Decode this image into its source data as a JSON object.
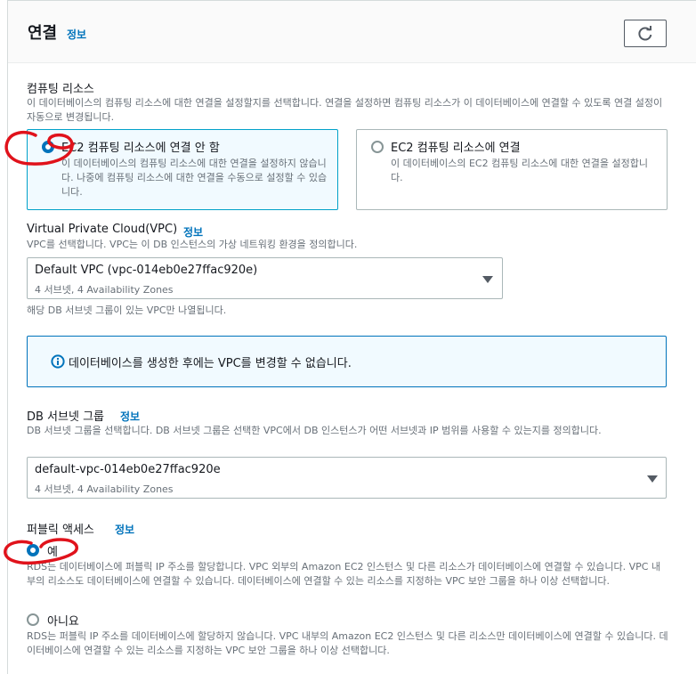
{
  "header": {
    "title": "연결",
    "info": "정보"
  },
  "compute": {
    "label": "컴퓨팅 리소스",
    "description": "이 데이터베이스의 컴퓨팅 리소스에 대한 연결을 설정할지를 선택합니다. 연결을 설정하면 컴퓨팅 리소스가 이 데이터베이스에 연결할 수 있도록 연결 설정이 자동으로 변경됩니다.",
    "options": [
      {
        "title": "EC2 컴퓨팅 리소스에 연결 안 함",
        "description": "이 데이터베이스의 컴퓨팅 리소스에 대한 연결을 설정하지 않습니다. 나중에 컴퓨팅 리소스에 대한 연결을 수동으로 설정할 수 있습니다.",
        "selected": true
      },
      {
        "title": "EC2 컴퓨팅 리소스에 연결",
        "description": "이 데이터베이스의 EC2 컴퓨팅 리소스에 대한 연결을 설정합니다.",
        "selected": false
      }
    ]
  },
  "vpc": {
    "label": "Virtual Private Cloud(VPC)",
    "info": "정보",
    "description": "VPC를 선택합니다. VPC는 이 DB 인스턴스의 가상 네트워킹 환경을 정의합니다.",
    "selected": "Default VPC (vpc-014eb0e27ffac920e)",
    "sub": "4 서브넷, 4 Availability Zones",
    "hint": "해당 DB 서브넷 그룹이 있는 VPC만 나열됩니다."
  },
  "alert": {
    "text": "데이터베이스를 생성한 후에는 VPC를 변경할 수 없습니다."
  },
  "subnet": {
    "label": "DB 서브넷 그룹",
    "info": "정보",
    "description": "DB 서브넷 그룹을 선택합니다. DB 서브넷 그룹은 선택한 VPC에서 DB 인스턴스가 어떤 서브넷과 IP 범위를 사용할 수 있는지를 정의합니다.",
    "selected": "default-vpc-014eb0e27ffac920e",
    "sub": "4 서브넷, 4 Availability Zones"
  },
  "public_access": {
    "label": "퍼블릭 액세스",
    "info": "정보",
    "options": [
      {
        "title": "예",
        "description": "RDS는 데이터베이스에 퍼블릭 IP 주소를 할당합니다. VPC 외부의 Amazon EC2 인스턴스 및 다른 리소스가 데이터베이스에 연결할 수 있습니다. VPC 내부의 리소스도 데이터베이스에 연결할 수 있습니다. 데이터베이스에 연결할 수 있는 리소스를 지정하는 VPC 보안 그룹을 하나 이상 선택합니다.",
        "selected": true
      },
      {
        "title": "아니요",
        "description": "RDS는 퍼블릭 IP 주소를 데이터베이스에 할당하지 않습니다. VPC 내부의 Amazon EC2 인스턴스 및 다른 리소스만 데이터베이스에 연결할 수 있습니다. 데이터베이스에 연결할 수 있는 리소스를 지정하는 VPC 보안 그룹을 하나 이상 선택합니다.",
        "selected": false
      }
    ]
  },
  "colors": {
    "accent": "#0073bb",
    "annotation": "#e0121b",
    "tile_selected_border": "#00a1c9"
  },
  "icons": [
    "refresh-icon",
    "caret-down-icon",
    "info-circle-icon"
  ]
}
